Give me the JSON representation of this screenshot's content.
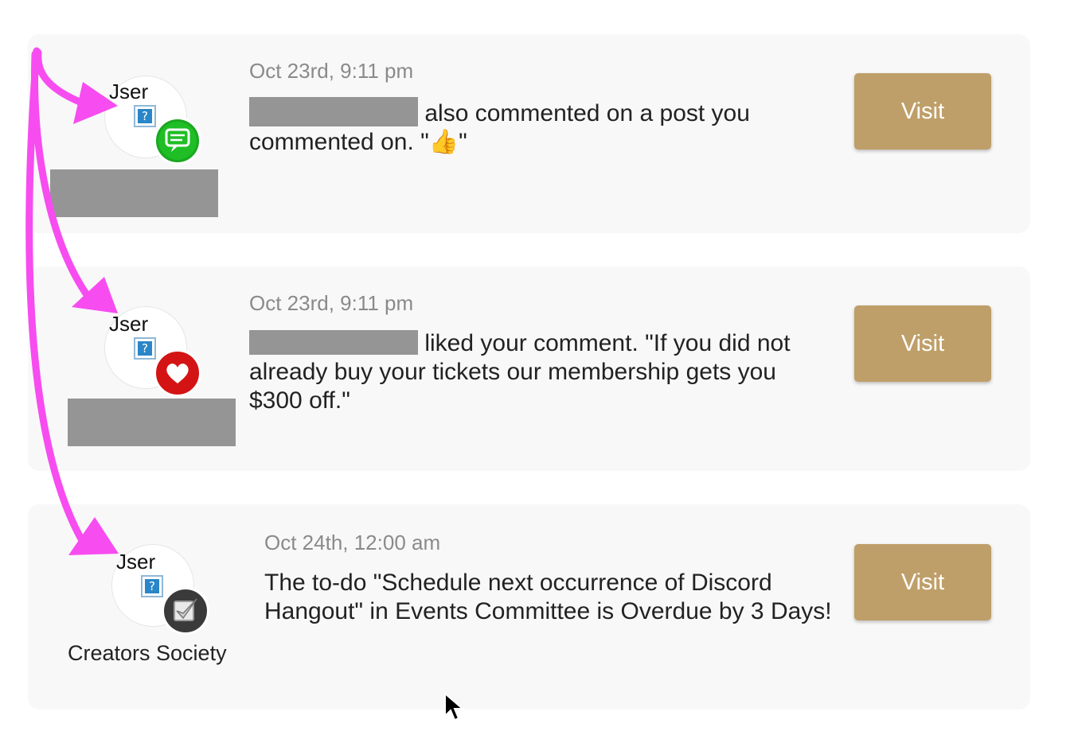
{
  "notifications": [
    {
      "time": "Oct 23rd, 9:11 pm",
      "message_after_name": "also commented on a post you commented on. \"👍\"",
      "avatar_alt": "Jser",
      "badge_icon": "chat-bubble-icon",
      "badge_color": "#19a81f",
      "visit_label": "Visit"
    },
    {
      "time": "Oct 23rd, 9:11 pm",
      "message_after_name": "liked your comment. \"If you did not already buy your tickets our membership gets you $300 off.\"",
      "avatar_alt": "Jser",
      "badge_icon": "heart-icon",
      "badge_color": "#d41414",
      "visit_label": "Visit"
    },
    {
      "time": "Oct 24th, 12:00 am",
      "message": "The to-do \"Schedule next occurrence of Discord Hangout\" in Events Committee is Overdue by 3 Days!",
      "avatar_alt": "Jser",
      "group_name": "Creators Society",
      "badge_icon": "checkmark-icon",
      "badge_color": "#3a3a3a",
      "visit_label": "Visit"
    }
  ],
  "broken_image_glyph": "?",
  "annotation_color": "#f74cf0",
  "accent_color": "#bf9f69"
}
